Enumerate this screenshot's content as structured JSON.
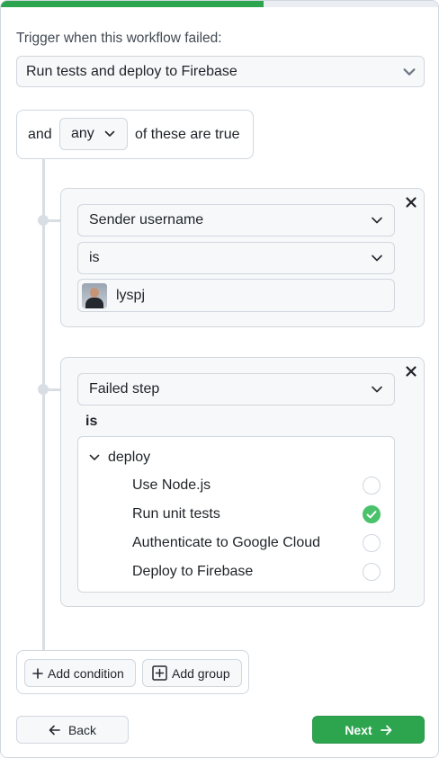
{
  "progress": {
    "fraction": 0.6
  },
  "trigger": {
    "label": "Trigger when this workflow failed:",
    "workflow_value": "Run tests and deploy to Firebase"
  },
  "rule": {
    "prefix": "and",
    "quantifier": "any",
    "suffix": "of these are true"
  },
  "conditions": [
    {
      "field": "Sender username",
      "operator": "is",
      "value_user": "lyspj"
    },
    {
      "field": "Failed step",
      "operator_label": "is",
      "job": "deploy",
      "steps": [
        {
          "label": "Use Node.js",
          "selected": false
        },
        {
          "label": "Run unit tests",
          "selected": true
        },
        {
          "label": "Authenticate to Google Cloud",
          "selected": false
        },
        {
          "label": "Deploy to Firebase",
          "selected": false
        }
      ]
    }
  ],
  "actions": {
    "add_condition": "Add condition",
    "add_group": "Add group"
  },
  "footer": {
    "back": "Back",
    "next": "Next"
  },
  "colors": {
    "accent_green": "#2da44e",
    "check_green": "#4ac26b",
    "border": "#d0d7de"
  },
  "icons": [
    "close-icon",
    "chevron-down-icon",
    "plus-icon",
    "plus-square-icon",
    "arrow-left-icon",
    "arrow-right-icon",
    "check-icon",
    "avatar"
  ]
}
